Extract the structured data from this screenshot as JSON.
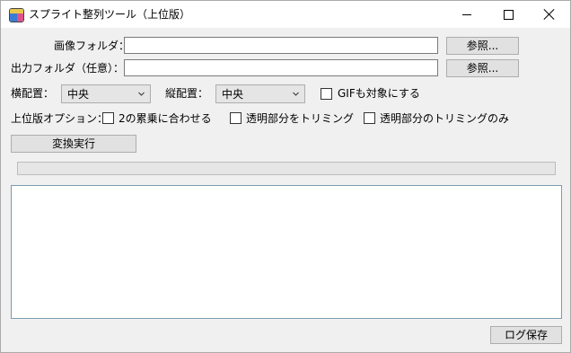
{
  "window": {
    "title": "スプライト整列ツール（上位版）",
    "icon": "sprite-app-icon"
  },
  "image_folder": {
    "label": "画像フォルダ：",
    "value": "",
    "browse_label": "参照..."
  },
  "output_folder": {
    "label": "出力フォルダ（任意）：",
    "value": "",
    "browse_label": "参照..."
  },
  "alignment": {
    "horizontal_label": "横配置：",
    "horizontal_value": "中央",
    "vertical_label": "縦配置：",
    "vertical_value": "中央",
    "gif_label": "GIFも対象にする",
    "gif_checked": false
  },
  "options": {
    "label": "上位版オプション：",
    "pow2_label": "2の累乗に合わせる",
    "pow2_checked": false,
    "trim_label": "透明部分をトリミング",
    "trim_checked": false,
    "trim_only_label": "透明部分のトリミングのみ",
    "trim_only_checked": false
  },
  "convert_button": "変換実行",
  "progress": 0,
  "log_text": "",
  "save_log_button": "ログ保存"
}
